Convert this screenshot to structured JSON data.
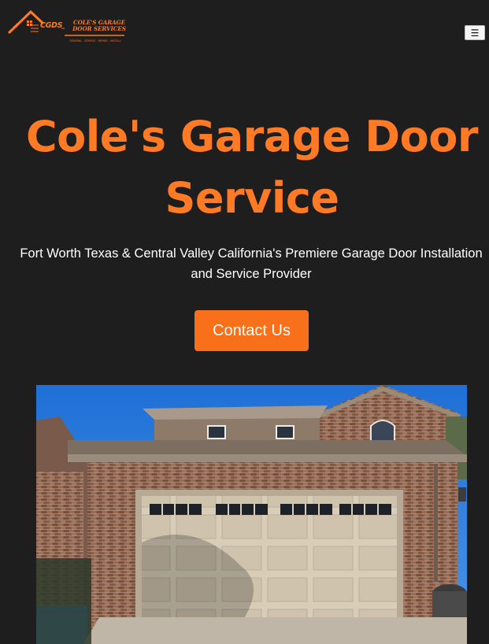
{
  "header": {
    "logo": {
      "monogram": "CGDS",
      "company_lines": [
        "COLE'S GARAGE",
        "DOOR SERVICES"
      ],
      "tagline": "GENERAL · SERVICE · REPAIR · INSTALL"
    },
    "menu_toggle_label": "☰"
  },
  "hero": {
    "title_line1": "Cole's Garage Door",
    "title_line2": "Service",
    "subtitle_line1": "Fort Worth Texas & Central Valley California's Premiere Garage Door Installation",
    "subtitle_line2": "and Service Provider",
    "cta_label": "Contact Us"
  },
  "colors": {
    "background": "#1e1e1e",
    "accent": "#ff7a25",
    "button": "#f8701a"
  },
  "icons": {
    "menu": "hamburger-icon",
    "logo": "house-roof-logo"
  }
}
